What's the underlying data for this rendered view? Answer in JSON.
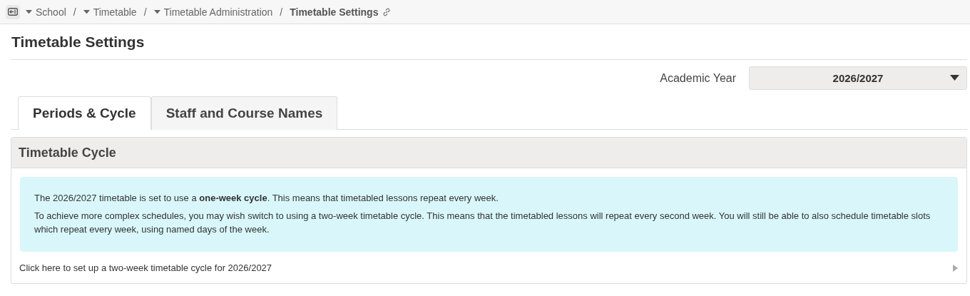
{
  "breadcrumbs": [
    {
      "label": "School",
      "has_menu": true
    },
    {
      "separator": "/",
      "label": "Timetable",
      "has_menu": true
    },
    {
      "separator": "/",
      "label": "Timetable Administration",
      "has_menu": true
    },
    {
      "separator": "/",
      "label": "Timetable Settings",
      "has_menu": false
    }
  ],
  "page_title": "Timetable Settings",
  "academic_year": {
    "label": "Academic Year",
    "value": "2026/2027"
  },
  "tabs": [
    {
      "label": "Periods & Cycle",
      "selected": true
    },
    {
      "label": "Staff and Course Names",
      "selected": false
    }
  ],
  "panel": {
    "title": "Timetable Cycle",
    "info": [
      "The 2026/2027 timetable is set to use a **one-week cycle**. This means that timetabled lessons repeat every week.",
      "To achieve more complex schedules, you may wish switch to using a two-week timetable cycle. This means that the timetabled lessons will repeat every second week. You will still be able to also schedule timetable slots which repeat every week, using named days of the week."
    ],
    "action": "Click here to set up a two-week timetable cycle for 2026/2027"
  }
}
